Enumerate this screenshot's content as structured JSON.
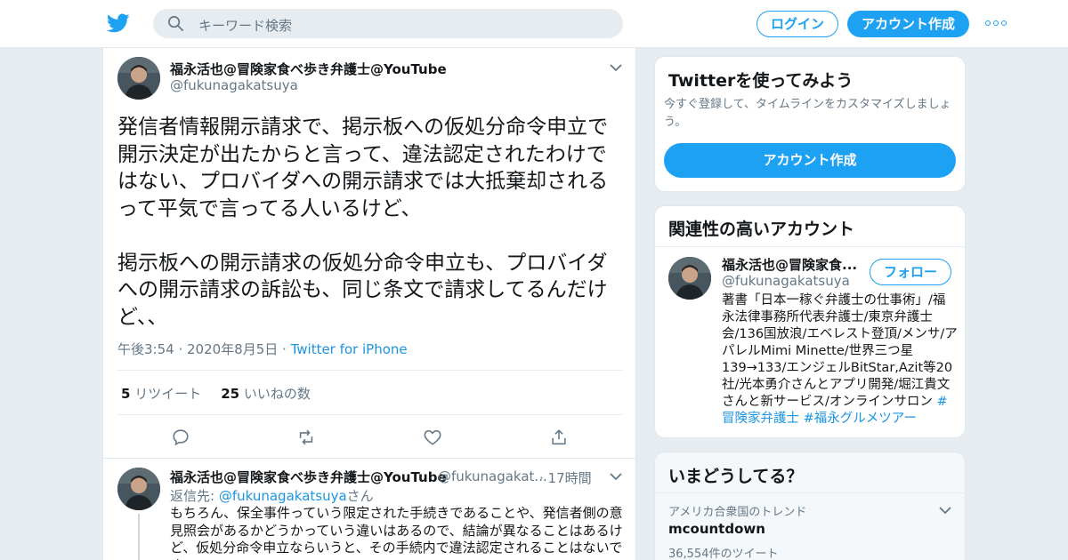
{
  "header": {
    "search_placeholder": "キーワード検索",
    "login_label": "ログイン",
    "signup_label": "アカウント作成"
  },
  "icons": {
    "logo": "twitter-bird-icon",
    "search": "search-icon",
    "more": "more-dots-icon",
    "caret": "chevron-down-icon",
    "reply": "reply-icon",
    "retweet": "retweet-icon",
    "like": "heart-icon",
    "share": "share-icon"
  },
  "colors": {
    "accent": "#1da1f2",
    "link": "#1b95e0",
    "text": "#14171a",
    "muted": "#657786",
    "background": "#e6ecf0"
  },
  "tweet": {
    "display_name": "福永活也@冒険家食べ歩き弁護士@YouTube",
    "handle": "@fukunagakatsuya",
    "text": "発信者情報開示請求で、掲示板への仮処分命令申立で\n開示決定が出たからと言って、違法認定されたわけで\nはない、プロバイダへの開示請求では大抵棄却される\nって平気で言ってる人いるけど、\n\n掲示板への開示請求の仮処分命令申立も、プロバイダ\nへの開示請求の訴訟も、同じ条文で請求してるんだけ\nど、、",
    "time": "午後3:54",
    "date": "2020年8月5日",
    "source": "Twitter for iPhone",
    "retweets_count": "5",
    "retweets_label": "リツイート",
    "likes_count": "25",
    "likes_label": "いいねの数"
  },
  "reply": {
    "display_name": "福永活也@冒険家食べ歩き弁護士@YouTube",
    "handle": "@fukunagakat...",
    "time": "17時間",
    "reply_to_label": "返信先:",
    "reply_to_handle": "@fukunagakatsuya",
    "reply_to_suffix": "さん",
    "text": "もちろん、保全事件っていう限定された手続きであることや、発信者側の意見照会があるかどうかっていう違いはあるので、結論が異なることはあるけど、仮処分命令申立ならいうと、その手続内で違法認定されることはないです"
  },
  "sidebar": {
    "signup_card": {
      "title": "Twitterを使ってみよう",
      "subtitle": "今すぐ登録して、タイムラインをカスタマイズしましょう。",
      "button_label": "アカウント作成"
    },
    "related_card": {
      "title": "関連性の高いアカウント",
      "name": "福永活也@冒険家食...",
      "handle": "@fukunagakatsuya",
      "follow_label": "フォロー",
      "bio": "著書「日本一稼ぐ弁護士の仕事術」/福永法律事務所代表弁護士/東京弁護士会/136国放浪/エベレスト登頂/メンサ/アパレルMimi Minette/世界三つ星139→133/エンジェルBitStar,Azit等20社/光本勇介さんとアプリ開発/堀江貴文さんと新サービス/オンラインサロン",
      "hashtag1": "#冒険家弁護士",
      "hashtag2": "#福永グルメツアー"
    },
    "trends_card": {
      "title": "いまどうしてる？",
      "category": "アメリカ合衆国のトレンド",
      "trend_name": "mcountdown",
      "tweet_count": "36,554件のツイート"
    }
  }
}
